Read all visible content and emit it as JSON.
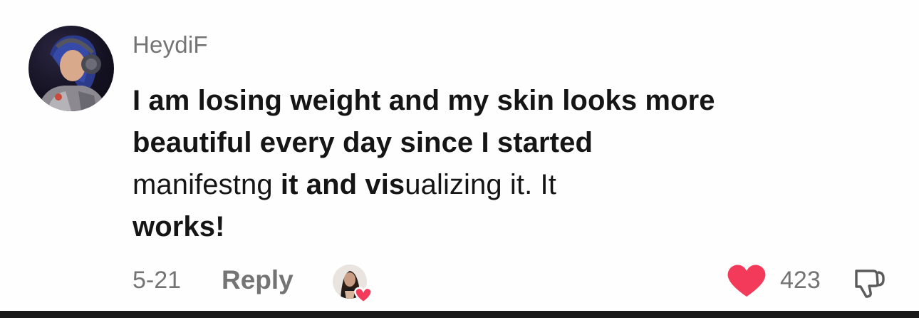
{
  "comment": {
    "username": "HeydiF",
    "body_lines": [
      "I am losing weight and my skin looks more",
      "beautiful every day since I started",
      "manifestng",
      " it and vis",
      "ualizing",
      " it. It",
      "works!"
    ],
    "date": "5-21",
    "reply_label": "Reply",
    "like_count": "423",
    "like_color": "#f43a5a",
    "text_color": "#151515",
    "muted_color": "#747474"
  },
  "icons": {
    "avatar": "user-avatar",
    "creator_like": "creator-liked-heart-avatar",
    "like": "heart-icon",
    "dislike": "thumbs-down-icon"
  }
}
